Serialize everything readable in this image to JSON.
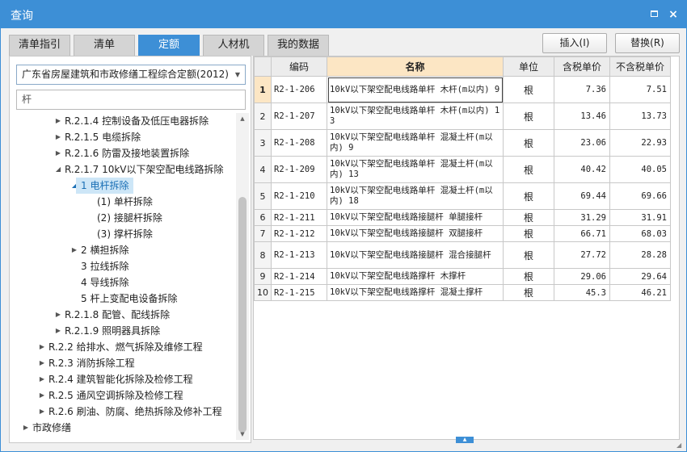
{
  "window": {
    "title": "查询"
  },
  "titlebar": {
    "maximize_label": "",
    "close_label": "×"
  },
  "tabs": [
    {
      "label": "清单指引",
      "active": false
    },
    {
      "label": "清单",
      "active": false
    },
    {
      "label": "定额",
      "active": true
    },
    {
      "label": "人材机",
      "active": false
    },
    {
      "label": "我的数据",
      "active": false
    }
  ],
  "buttons": {
    "insert": "插入(I)",
    "replace": "替换(R)"
  },
  "left": {
    "library": "广东省房屋建筑和市政修缮工程综合定额(2012)",
    "search_value": "杆",
    "tree": [
      {
        "label": "R.2.1.4 控制设备及低压电器拆除",
        "arrow": "▶",
        "level": 3
      },
      {
        "label": "R.2.1.5 电缆拆除",
        "arrow": "▶",
        "level": 3
      },
      {
        "label": "R.2.1.6 防雷及接地装置拆除",
        "arrow": "▶",
        "level": 3
      },
      {
        "label": "R.2.1.7 10kV以下架空配电线路拆除",
        "arrow": "◢",
        "level": 3
      },
      {
        "label": "1 电杆拆除",
        "arrow": "◢",
        "level": 4,
        "selected": true
      },
      {
        "label": "(1) 单杆拆除",
        "arrow": "",
        "level": 5
      },
      {
        "label": "(2) 接腿杆拆除",
        "arrow": "",
        "level": 5
      },
      {
        "label": "(3) 撑杆拆除",
        "arrow": "",
        "level": 5
      },
      {
        "label": "2 横担拆除",
        "arrow": "▶",
        "level": 4
      },
      {
        "label": "3 拉线拆除",
        "arrow": "",
        "level": 4
      },
      {
        "label": "4 导线拆除",
        "arrow": "",
        "level": 4
      },
      {
        "label": "5 杆上变配电设备拆除",
        "arrow": "",
        "level": 4
      },
      {
        "label": "R.2.1.8 配管、配线拆除",
        "arrow": "▶",
        "level": 3
      },
      {
        "label": "R.2.1.9 照明器具拆除",
        "arrow": "▶",
        "level": 3
      },
      {
        "label": "R.2.2 给排水、燃气拆除及维修工程",
        "arrow": "▶",
        "level": 2
      },
      {
        "label": "R.2.3 消防拆除工程",
        "arrow": "▶",
        "level": 2
      },
      {
        "label": "R.2.4 建筑智能化拆除及检修工程",
        "arrow": "▶",
        "level": 2
      },
      {
        "label": "R.2.5 通风空调拆除及检修工程",
        "arrow": "▶",
        "level": 2
      },
      {
        "label": "R.2.6 刷油、防腐、绝热拆除及修补工程",
        "arrow": "▶",
        "level": 2
      },
      {
        "label": "市政修缮",
        "arrow": "▶",
        "level": 1
      }
    ]
  },
  "table": {
    "columns": [
      "",
      "编码",
      "名称",
      "单位",
      "含税单价",
      "不含税单价"
    ],
    "rows": [
      {
        "idx": "1",
        "code": "R2-1-206",
        "name": "10kV以下架空配电线路单杆 木杆(m以内) 9",
        "unit": "根",
        "price_tax": "7.36",
        "price_notax": "7.51"
      },
      {
        "idx": "2",
        "code": "R2-1-207",
        "name": "10kV以下架空配电线路单杆 木杆(m以内) 13",
        "unit": "根",
        "price_tax": "13.46",
        "price_notax": "13.73"
      },
      {
        "idx": "3",
        "code": "R2-1-208",
        "name": "10kV以下架空配电线路单杆 混凝土杆(m以内) 9",
        "unit": "根",
        "price_tax": "23.06",
        "price_notax": "22.93"
      },
      {
        "idx": "4",
        "code": "R2-1-209",
        "name": "10kV以下架空配电线路单杆 混凝土杆(m以内) 13",
        "unit": "根",
        "price_tax": "40.42",
        "price_notax": "40.05"
      },
      {
        "idx": "5",
        "code": "R2-1-210",
        "name": "10kV以下架空配电线路单杆 混凝土杆(m以内) 18",
        "unit": "根",
        "price_tax": "69.44",
        "price_notax": "69.66"
      },
      {
        "idx": "6",
        "code": "R2-1-211",
        "name": "10kV以下架空配电线路接腿杆 单腿接杆",
        "unit": "根",
        "price_tax": "31.29",
        "price_notax": "31.91"
      },
      {
        "idx": "7",
        "code": "R2-1-212",
        "name": "10kV以下架空配电线路接腿杆 双腿接杆",
        "unit": "根",
        "price_tax": "66.71",
        "price_notax": "68.03"
      },
      {
        "idx": "8",
        "code": "R2-1-213",
        "name": "10kV以下架空配电线路接腿杆 混合接腿杆",
        "unit": "根",
        "price_tax": "27.72",
        "price_notax": "28.28"
      },
      {
        "idx": "9",
        "code": "R2-1-214",
        "name": "10kV以下架空配电线路撑杆 木撑杆",
        "unit": "根",
        "price_tax": "29.06",
        "price_notax": "29.64"
      },
      {
        "idx": "10",
        "code": "R2-1-215",
        "name": "10kV以下架空配电线路撑杆 混凝土撑杆",
        "unit": "根",
        "price_tax": "45.3",
        "price_notax": "46.21"
      }
    ]
  },
  "colors": {
    "accent": "#3d8fd6",
    "highlight": "#fce6c4",
    "selection": "#cde6f7"
  }
}
